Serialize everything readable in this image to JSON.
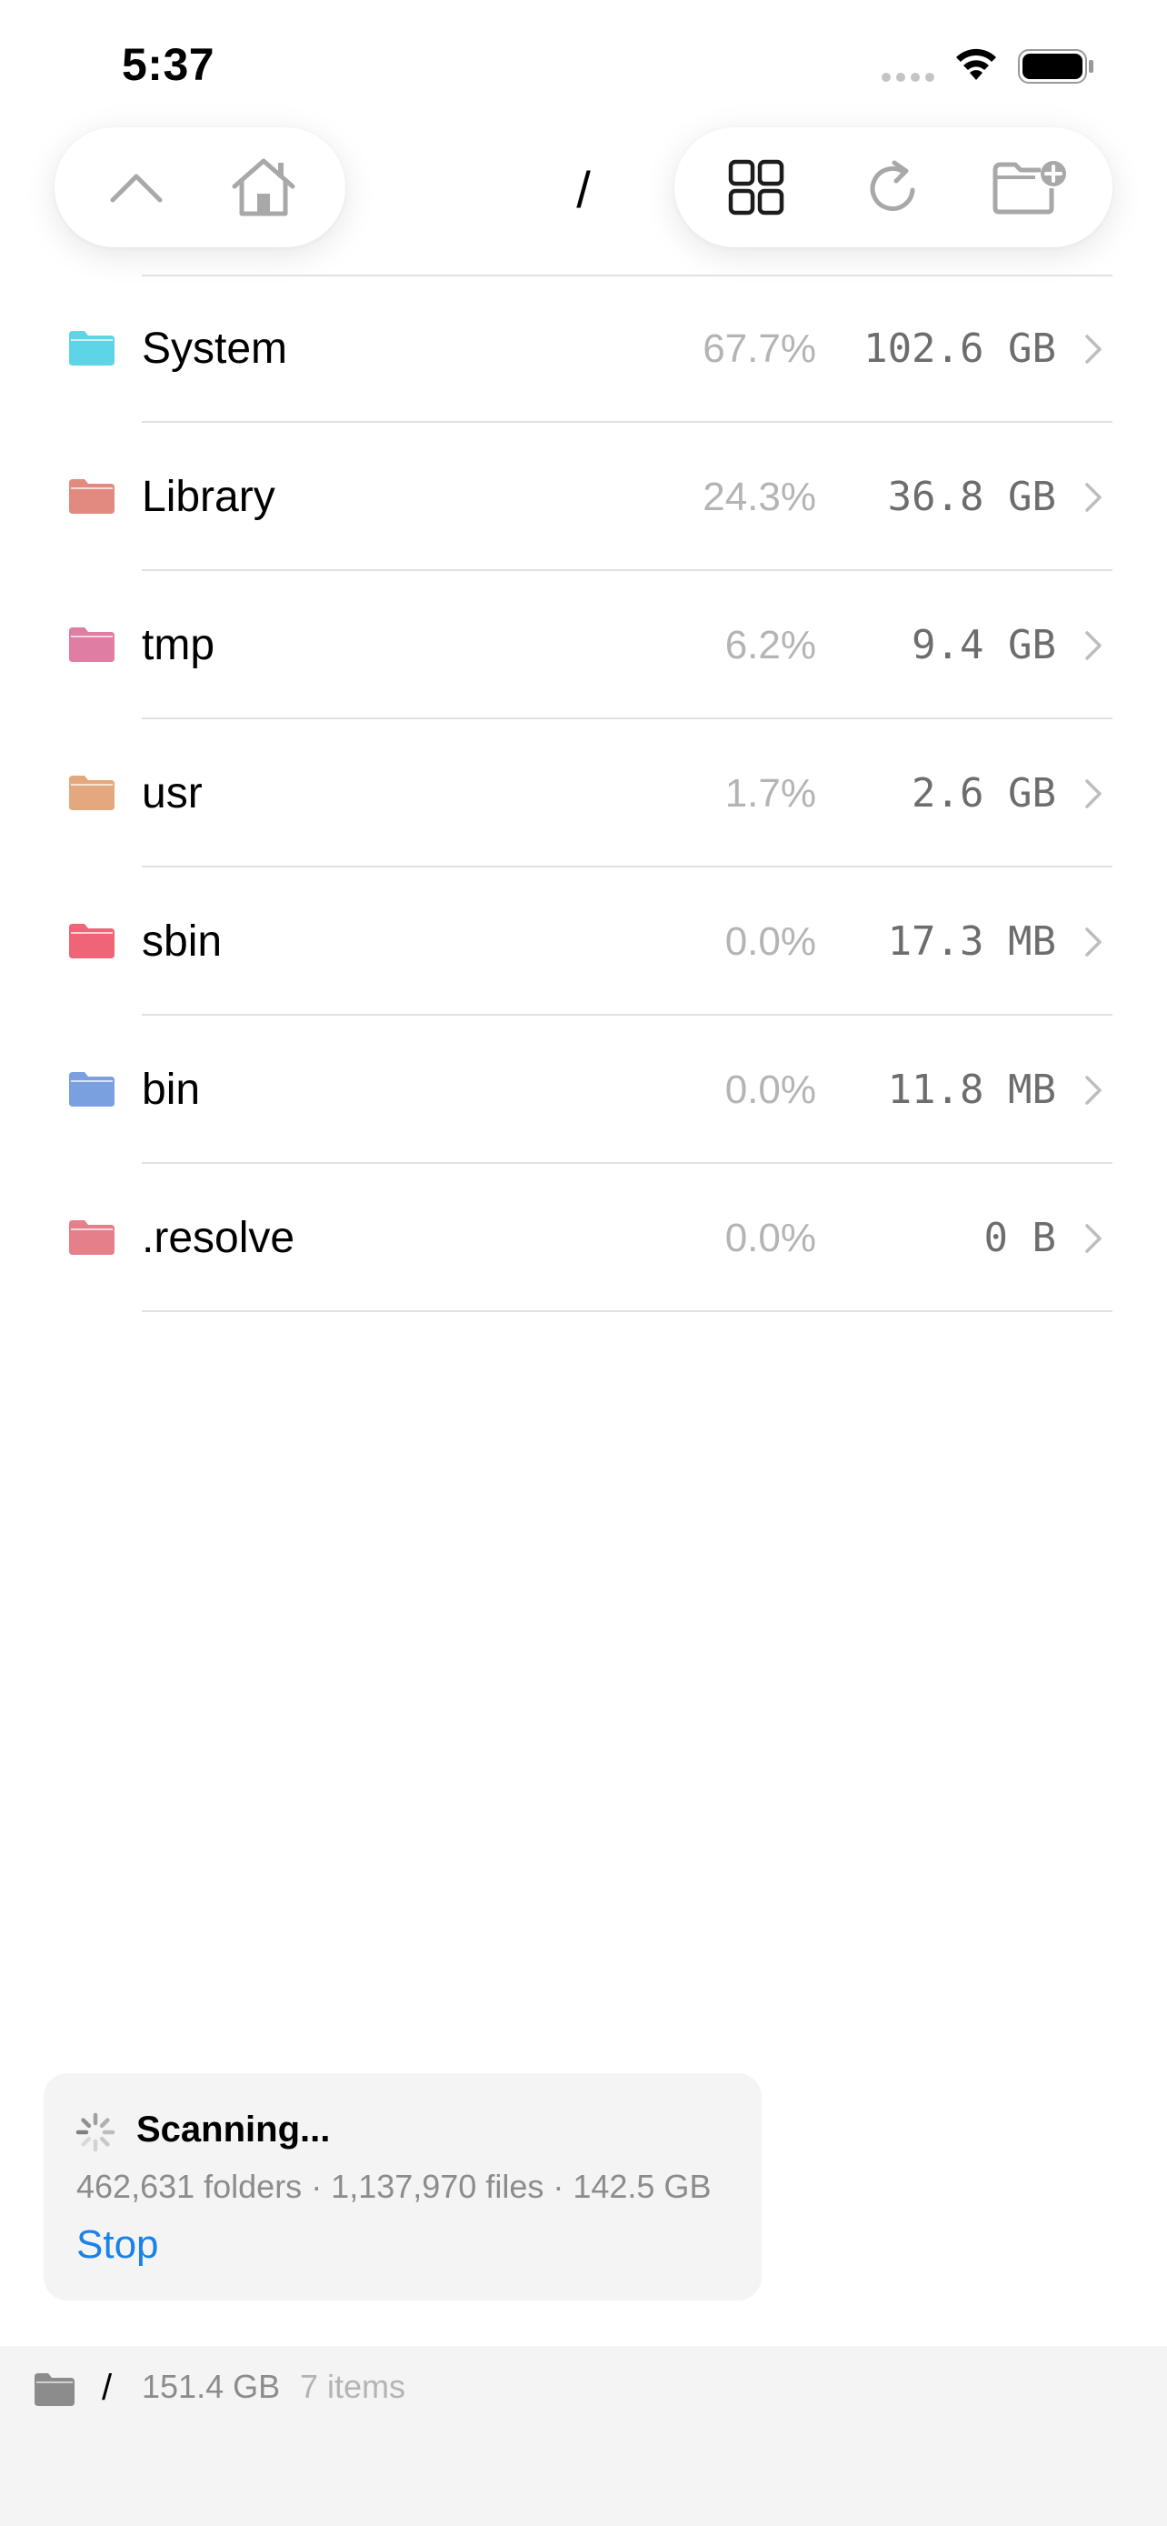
{
  "status_bar": {
    "time": "5:37"
  },
  "toolbar": {
    "path_title": "/",
    "buttons": [
      "up-chevron-icon",
      "home-icon",
      "grid-view-icon",
      "refresh-icon",
      "new-folder-icon"
    ]
  },
  "folders": [
    {
      "name": "System",
      "percent": "67.7%",
      "size": "102.6 GB",
      "color": "#5ed5e6"
    },
    {
      "name": "Library",
      "percent": "24.3%",
      "size": "36.8 GB",
      "color": "#e28a7f"
    },
    {
      "name": "tmp",
      "percent": "6.2%",
      "size": "9.4 GB",
      "color": "#e07da3"
    },
    {
      "name": "usr",
      "percent": "1.7%",
      "size": "2.6 GB",
      "color": "#e3a87e"
    },
    {
      "name": "sbin",
      "percent": "0.0%",
      "size": "17.3 MB",
      "color": "#ee6577"
    },
    {
      "name": "bin",
      "percent": "0.0%",
      "size": "11.8 MB",
      "color": "#7aa0e0"
    },
    {
      "name": ".resolve",
      "percent": "0.0%",
      "size": "0 B",
      "color": "#e57f8a"
    }
  ],
  "scan": {
    "title": "Scanning...",
    "detail": "462,631 folders · 1,137,970 files · 142.5 GB",
    "stop_label": "Stop"
  },
  "footer": {
    "path": "/",
    "size": "151.4 GB",
    "count": "7 items"
  },
  "colors": {
    "accent": "#1a82e8",
    "icon_gray": "#a8a8a8"
  }
}
